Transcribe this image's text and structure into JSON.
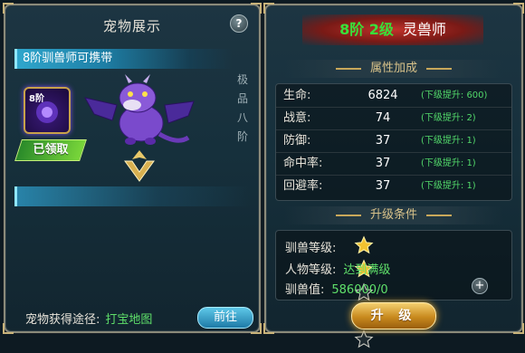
{
  "pet_display": {
    "title": "宠物展示",
    "help_label": "?",
    "carry_notice": "8阶驯兽师可携带",
    "stage_badge_text": "8阶",
    "claimed_label": "已领取",
    "vertical_label": [
      "极",
      "品",
      "八",
      "阶"
    ],
    "source_label": "宠物获得途径:",
    "source_link": "打宝地图",
    "go_button": "前往"
  },
  "trainer": {
    "rank": "8阶 2级",
    "title": "灵兽师",
    "attributes_header": "属性加成",
    "stats": [
      {
        "name": "生命:",
        "value": "6824",
        "next": "(下级提升: 600)"
      },
      {
        "name": "战意:",
        "value": "74",
        "next": "(下级提升: 2)"
      },
      {
        "name": "防御:",
        "value": "37",
        "next": "(下级提升: 1)"
      },
      {
        "name": "命中率:",
        "value": "37",
        "next": "(下级提升: 1)"
      },
      {
        "name": "回避率:",
        "value": "37",
        "next": "(下级提升: 1)"
      }
    ],
    "conditions_header": "升级条件",
    "conditions": {
      "trainer_level_label": "驯兽等级:",
      "stars_filled": 2,
      "stars_total": 5,
      "char_level_label": "人物等级:",
      "char_level_value": "达到满级",
      "exp_label": "驯兽值:",
      "exp_value": "586000/0"
    },
    "plus_label": "+",
    "upgrade_button": "升 级"
  },
  "colors": {
    "green": "#39e03a",
    "gold": "#d8c28a",
    "cyan": "#2fa6cc"
  }
}
